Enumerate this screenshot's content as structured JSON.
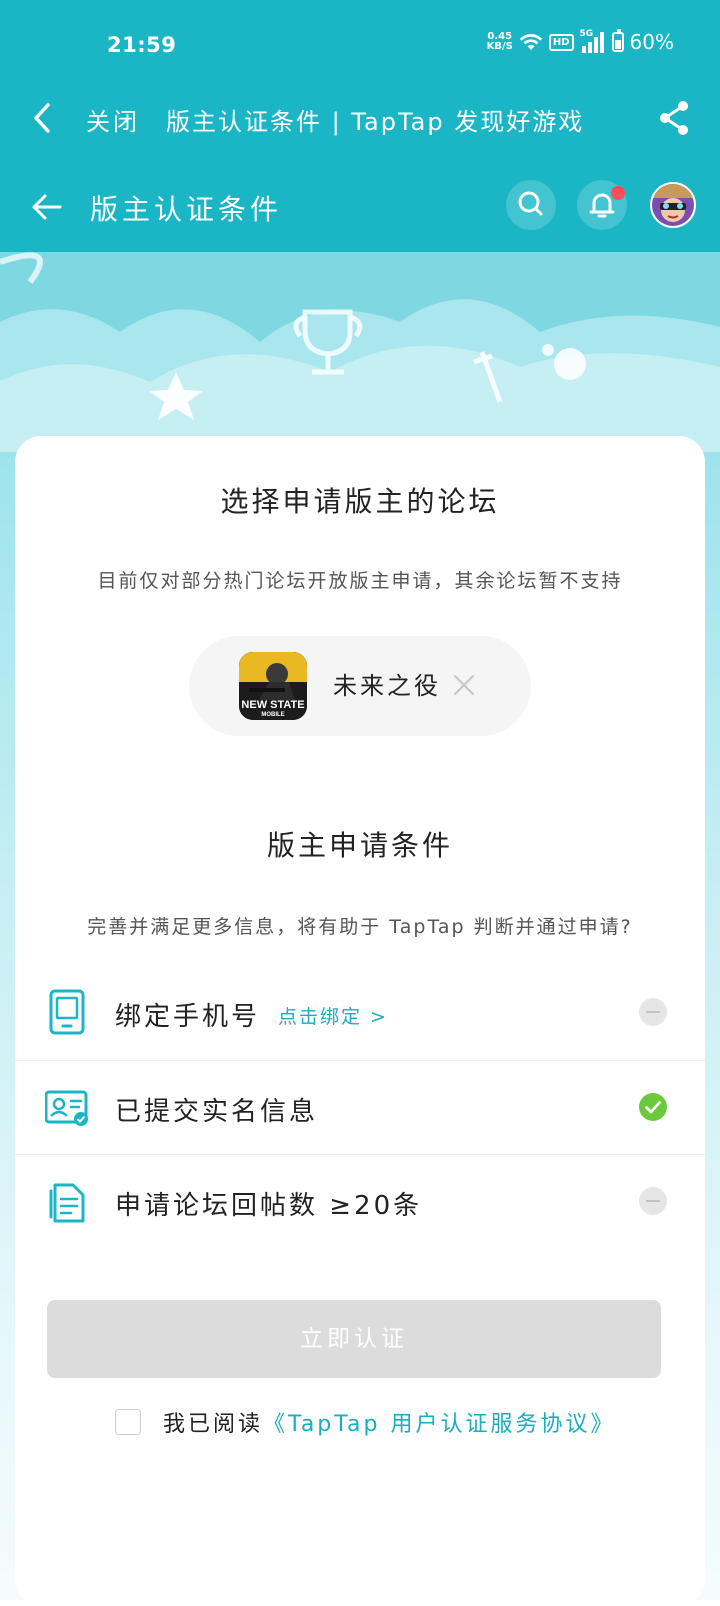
{
  "status_bar": {
    "time": "21:59",
    "net_speed_value": "0.45",
    "net_speed_unit": "KB/S",
    "hd_label": "HD",
    "network_label": "5G",
    "battery": "60%"
  },
  "titlebar": {
    "close_label": "关闭",
    "page_title": "版主认证条件 | TapTap 发现好游戏"
  },
  "subbar": {
    "title": "版主认证条件",
    "has_notification": true
  },
  "forum_section": {
    "title": "选择申请版主的论坛",
    "description": "目前仅对部分热门论坛开放版主申请，其余论坛暂不支持",
    "selected_game": {
      "name": "未来之役",
      "icon_text_line1": "NEW STATE",
      "icon_text_line2": "MOBILE"
    }
  },
  "conditions_section": {
    "title": "版主申请条件",
    "description": "完善并满足更多信息，将有助于 TapTap 判断并通过申请?",
    "items": [
      {
        "label": "绑定手机号",
        "link": "点击绑定 >",
        "icon": "phone-icon",
        "status": "pending"
      },
      {
        "label": "已提交实名信息",
        "icon": "id-card-icon",
        "status": "done"
      },
      {
        "label": "申请论坛回帖数 ≥20条",
        "icon": "document-icon",
        "status": "pending"
      }
    ]
  },
  "verify_button": "立即认证",
  "agreement": {
    "prefix": "我已阅读",
    "link": "《TapTap 用户认证服务协议》",
    "checked": false
  },
  "colors": {
    "header_teal": "#1bb6c6",
    "accent_link": "#19aebf",
    "success_green": "#6bc93b",
    "notification_red": "#ff4d5a",
    "disabled_button": "#dcdcdc"
  }
}
